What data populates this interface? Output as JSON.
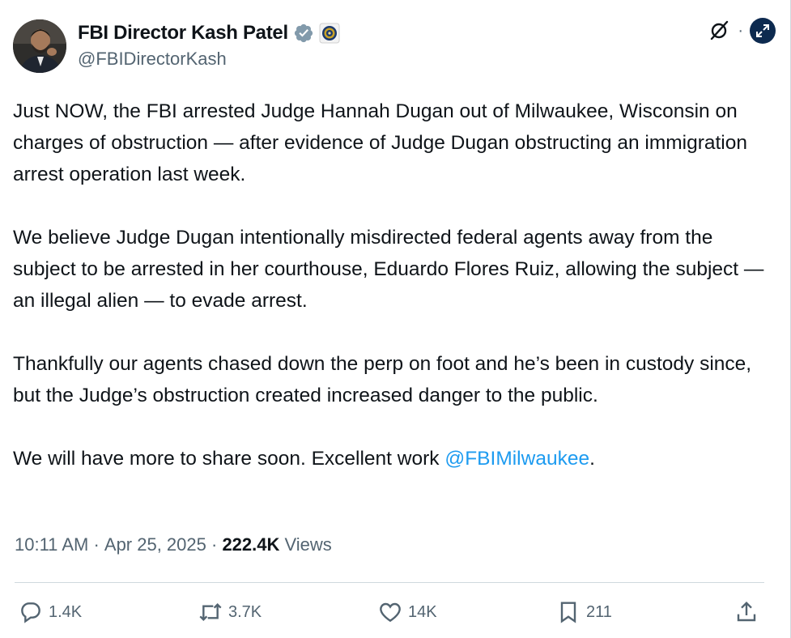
{
  "author": {
    "display_name": "FBI Director Kash Patel",
    "handle": "@FBIDirectorKash",
    "verified_icon": "verified-badge-icon",
    "affiliation_icon": "fbi-seal-icon"
  },
  "header_actions": {
    "grok_icon": "grok-icon",
    "separator": "·",
    "expand_icon": "expand-icon"
  },
  "body": {
    "p1": "Just NOW, the FBI arrested Judge Hannah Dugan out of Milwaukee, Wisconsin on charges of obstruction — after evidence of Judge Dugan obstructing an immigration arrest operation last week.",
    "p2": "We believe Judge Dugan intentionally misdirected federal agents away from the subject to be arrested in her courthouse, Eduardo Flores Ruiz, allowing the subject — an illegal alien — to evade arrest.",
    "p3": "Thankfully our agents chased down the perp on foot and he’s been in custody since, but the Judge’s obstruction created increased danger to the public.",
    "p4_before": "We will have more to share soon. Excellent work ",
    "p4_mention": "@FBIMilwaukee",
    "p4_after": "."
  },
  "meta": {
    "time": "10:11 AM",
    "sep1": " · ",
    "date": "Apr 25, 2025",
    "sep2": " · ",
    "views_count": "222.4K",
    "views_label": " Views"
  },
  "actions": {
    "reply_count": "1.4K",
    "repost_count": "3.7K",
    "like_count": "14K",
    "bookmark_count": "211"
  },
  "colors": {
    "text": "#0f1419",
    "secondary": "#536471",
    "link": "#1d9bf0",
    "divider": "#cfd9de"
  }
}
